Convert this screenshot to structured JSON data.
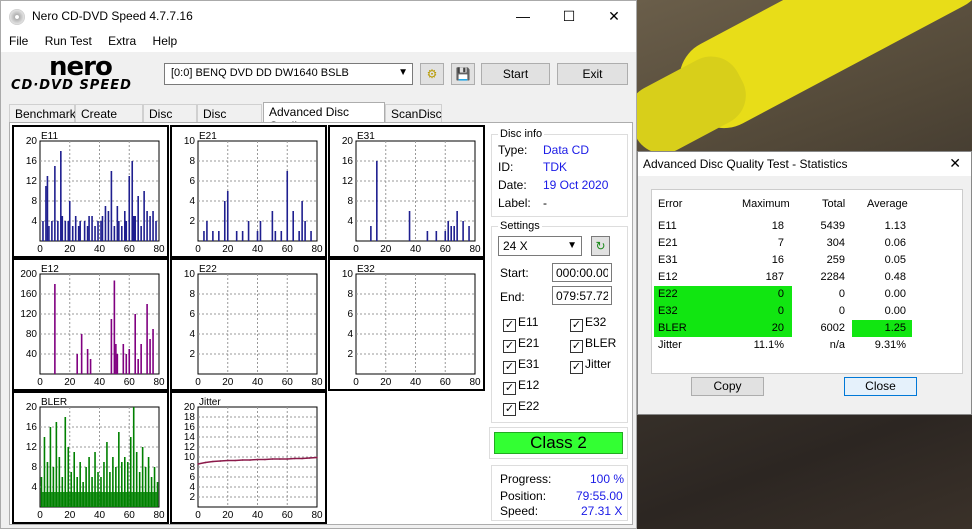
{
  "app": {
    "title": "Nero CD-DVD Speed 4.7.7.16",
    "menu": [
      "File",
      "Run Test",
      "Extra",
      "Help"
    ],
    "logo_top": "nero",
    "logo_bottom": "CD·DVD SPEED",
    "drive": "[0:0]   BENQ DVD DD DW1640 BSLB",
    "start_label": "Start",
    "exit_label": "Exit",
    "tabs": [
      "Benchmark",
      "Create Disc",
      "Disc Info",
      "Disc Quality",
      "Advanced Disc Quality",
      "ScanDisc"
    ],
    "active_tab": "Advanced Disc Quality"
  },
  "disc_info": {
    "heading": "Disc info",
    "type_label": "Type:",
    "type": "Data CD",
    "id_label": "ID:",
    "id": "TDK",
    "date_label": "Date:",
    "date": "19 Oct 2020",
    "label_label": "Label:",
    "label": "-"
  },
  "settings": {
    "heading": "Settings",
    "speed": "24 X",
    "start_label": "Start:",
    "start": "000:00.00",
    "end_label": "End:",
    "end": "079:57.72",
    "checks": [
      {
        "label": "E11",
        "checked": true
      },
      {
        "label": "E32",
        "checked": true
      },
      {
        "label": "E21",
        "checked": true
      },
      {
        "label": "BLER",
        "checked": true
      },
      {
        "label": "E31",
        "checked": true
      },
      {
        "label": "Jitter",
        "checked": true
      },
      {
        "label": "E12",
        "checked": true
      },
      {
        "label": "E22",
        "checked": true
      }
    ]
  },
  "class_result": "Class 2",
  "progress": {
    "progress_label": "Progress:",
    "progress": "100 %",
    "position_label": "Position:",
    "position": "79:55.00",
    "speed_label": "Speed:",
    "speed": "27.31 X"
  },
  "colors": {
    "e_series": "#1f1f8f",
    "e12": "#800080",
    "bler": "#008000",
    "jitter": "#8b1a4a",
    "highlight": "#11e611"
  },
  "stats": {
    "title": "Advanced Disc Quality Test - Statistics",
    "headers": [
      "Error",
      "Maximum",
      "Total",
      "Average"
    ],
    "rows": [
      {
        "error": "E11",
        "maximum": "18",
        "total": "5439",
        "average": "1.13"
      },
      {
        "error": "E21",
        "maximum": "7",
        "total": "304",
        "average": "0.06"
      },
      {
        "error": "E31",
        "maximum": "16",
        "total": "259",
        "average": "0.05"
      },
      {
        "error": "E12",
        "maximum": "187",
        "total": "2284",
        "average": "0.48"
      },
      {
        "error": "E22",
        "maximum": "0",
        "total": "0",
        "average": "0.00"
      },
      {
        "error": "E32",
        "maximum": "0",
        "total": "0",
        "average": "0.00"
      },
      {
        "error": "BLER",
        "maximum": "20",
        "total": "6002",
        "average": "1.25"
      },
      {
        "error": "Jitter",
        "maximum": "11.1%",
        "total": "n/a",
        "average": "9.31%"
      }
    ],
    "copy_label": "Copy",
    "close_label": "Close"
  },
  "chart_data": [
    {
      "type": "bar",
      "title": "E11",
      "x_ticks": [
        0,
        20,
        40,
        60,
        80
      ],
      "y_ticks": [
        4,
        8,
        12,
        16,
        20
      ],
      "xlim": [
        0,
        80
      ],
      "ylim": [
        0,
        20
      ],
      "series_color": "#1f1f8f",
      "x": [
        2,
        4,
        5,
        6,
        8,
        10,
        12,
        14,
        15,
        17,
        19,
        20,
        22,
        24,
        26,
        27,
        30,
        32,
        33,
        35,
        37,
        39,
        41,
        42,
        44,
        46,
        48,
        50,
        52,
        53,
        55,
        57,
        58,
        60,
        62,
        63,
        64,
        66,
        68,
        70,
        72,
        74,
        76,
        78
      ],
      "values": [
        4,
        11,
        13,
        3,
        4,
        15,
        4,
        18,
        5,
        4,
        4,
        8,
        3,
        5,
        3,
        4,
        4,
        3,
        5,
        5,
        3,
        4,
        4,
        5,
        7,
        6,
        14,
        3,
        7,
        4,
        3,
        6,
        4,
        13,
        16,
        5,
        5,
        9,
        3,
        10,
        6,
        5,
        6,
        4
      ]
    },
    {
      "type": "bar",
      "title": "E21",
      "x_ticks": [
        0,
        20,
        40,
        60,
        80
      ],
      "y_ticks": [
        2,
        4,
        6,
        8,
        10
      ],
      "xlim": [
        0,
        80
      ],
      "ylim": [
        0,
        10
      ],
      "series_color": "#1f1f8f",
      "x": [
        4,
        6,
        10,
        14,
        18,
        20,
        26,
        30,
        34,
        40,
        42,
        50,
        52,
        56,
        60,
        64,
        68,
        70,
        72,
        76
      ],
      "values": [
        1,
        2,
        1,
        1,
        4,
        5,
        1,
        1,
        2,
        1,
        2,
        3,
        1,
        1,
        7,
        3,
        1,
        4,
        2,
        1
      ]
    },
    {
      "type": "bar",
      "title": "E31",
      "x_ticks": [
        0,
        20,
        40,
        60,
        80
      ],
      "y_ticks": [
        4,
        8,
        12,
        16,
        20
      ],
      "xlim": [
        0,
        80
      ],
      "ylim": [
        0,
        20
      ],
      "series_color": "#1f1f8f",
      "x": [
        10,
        14,
        36,
        48,
        54,
        60,
        62,
        64,
        66,
        68,
        72,
        76
      ],
      "values": [
        3,
        16,
        6,
        2,
        2,
        2,
        4,
        3,
        3,
        6,
        4,
        3
      ]
    },
    {
      "type": "bar",
      "title": "E12",
      "x_ticks": [
        0,
        20,
        40,
        60,
        80
      ],
      "y_ticks": [
        40,
        80,
        120,
        160,
        200
      ],
      "xlim": [
        0,
        80
      ],
      "ylim": [
        0,
        200
      ],
      "series_color": "#800080",
      "x": [
        10,
        25,
        28,
        32,
        34,
        48,
        50,
        51,
        52,
        56,
        58,
        60,
        64,
        66,
        68,
        72,
        74,
        76
      ],
      "values": [
        180,
        40,
        80,
        50,
        30,
        110,
        187,
        60,
        40,
        60,
        40,
        50,
        120,
        30,
        60,
        140,
        70,
        90
      ]
    },
    {
      "type": "bar",
      "title": "E22",
      "x_ticks": [
        0,
        20,
        40,
        60,
        80
      ],
      "y_ticks": [
        2,
        4,
        6,
        8,
        10
      ],
      "xlim": [
        0,
        80
      ],
      "ylim": [
        0,
        10
      ],
      "series_color": "#1f1f8f",
      "x": [],
      "values": []
    },
    {
      "type": "bar",
      "title": "E32",
      "x_ticks": [
        0,
        20,
        40,
        60,
        80
      ],
      "y_ticks": [
        2,
        4,
        6,
        8,
        10
      ],
      "xlim": [
        0,
        80
      ],
      "ylim": [
        0,
        10
      ],
      "series_color": "#1f1f8f",
      "x": [],
      "values": []
    },
    {
      "type": "bar",
      "title": "BLER",
      "x_ticks": [
        0,
        20,
        40,
        60,
        80
      ],
      "y_ticks": [
        4,
        8,
        12,
        16,
        20
      ],
      "xlim": [
        0,
        80
      ],
      "ylim": [
        0,
        20
      ],
      "series_color": "#008000",
      "x": [
        1,
        3,
        5,
        7,
        9,
        11,
        13,
        15,
        17,
        19,
        21,
        23,
        25,
        27,
        29,
        31,
        33,
        35,
        37,
        39,
        41,
        43,
        45,
        47,
        49,
        51,
        53,
        55,
        57,
        59,
        61,
        63,
        65,
        67,
        69,
        71,
        73,
        75,
        77,
        79
      ],
      "values": [
        6,
        14,
        9,
        16,
        8,
        17,
        10,
        6,
        18,
        12,
        7,
        11,
        6,
        9,
        5,
        8,
        10,
        6,
        11,
        7,
        6,
        9,
        13,
        7,
        10,
        8,
        15,
        9,
        10,
        9,
        14,
        20,
        11,
        7,
        12,
        8,
        10,
        6,
        8,
        5
      ]
    },
    {
      "type": "line",
      "title": "Jitter",
      "x_ticks": [
        0,
        20,
        40,
        60,
        80
      ],
      "y_ticks": [
        2,
        4,
        6,
        8,
        10,
        12,
        14,
        16,
        18,
        20
      ],
      "xlim": [
        0,
        80
      ],
      "ylim": [
        0,
        20
      ],
      "series_color": "#8b1a4a",
      "x": [
        0,
        5,
        10,
        15,
        20,
        25,
        30,
        35,
        40,
        45,
        50,
        55,
        60,
        65,
        70,
        75,
        80
      ],
      "values": [
        8.6,
        8.9,
        9.1,
        9.2,
        9.3,
        9.3,
        9.4,
        9.4,
        9.5,
        9.5,
        9.6,
        9.6,
        9.6,
        9.7,
        9.7,
        9.8,
        9.9
      ]
    }
  ]
}
